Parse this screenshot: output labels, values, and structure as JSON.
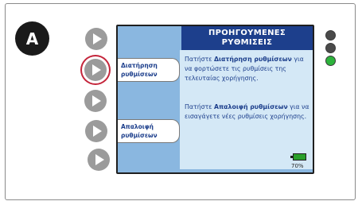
{
  "badge_label": "A",
  "screen": {
    "title_line1": "ΠΡΟΗΓΟΥΜΕΝΕΣ",
    "title_line2": "ΡΥΘΜΙΣΕΙΣ",
    "msg1_pre": "Πατήστε ",
    "msg1_bold": "Διατήρηση ρυθμίσεων",
    "msg1_post": " για να φορτώσετε τις ρυθμίσεις της τελευταίας χορήγησης.",
    "msg2_pre": "Πατήστε ",
    "msg2_bold": "Απαλοιφή ρυθμίσεων",
    "msg2_post": " για να εισαγάγετε νέες ρυθμίσεις χορήγησης.",
    "softkey_keep": "Διατήρηση ρυθμίσεων",
    "softkey_clear": "Απαλοιφή ρυθμίσεων",
    "battery_percent": "70%"
  },
  "side_buttons": [
    {
      "id": "softkey-1",
      "selected": false
    },
    {
      "id": "softkey-2",
      "selected": true
    },
    {
      "id": "softkey-3",
      "selected": false
    },
    {
      "id": "softkey-4",
      "selected": false
    },
    {
      "id": "softkey-5",
      "selected": false
    }
  ],
  "status_leds": [
    "#4a4a4a",
    "#4a4a4a",
    "#2db33c"
  ],
  "colors": {
    "title_bar": "#1d3f8c",
    "screen_bg": "#8ab7e0",
    "selected_ring": "#c4243a",
    "battery": "#2aa02a"
  }
}
